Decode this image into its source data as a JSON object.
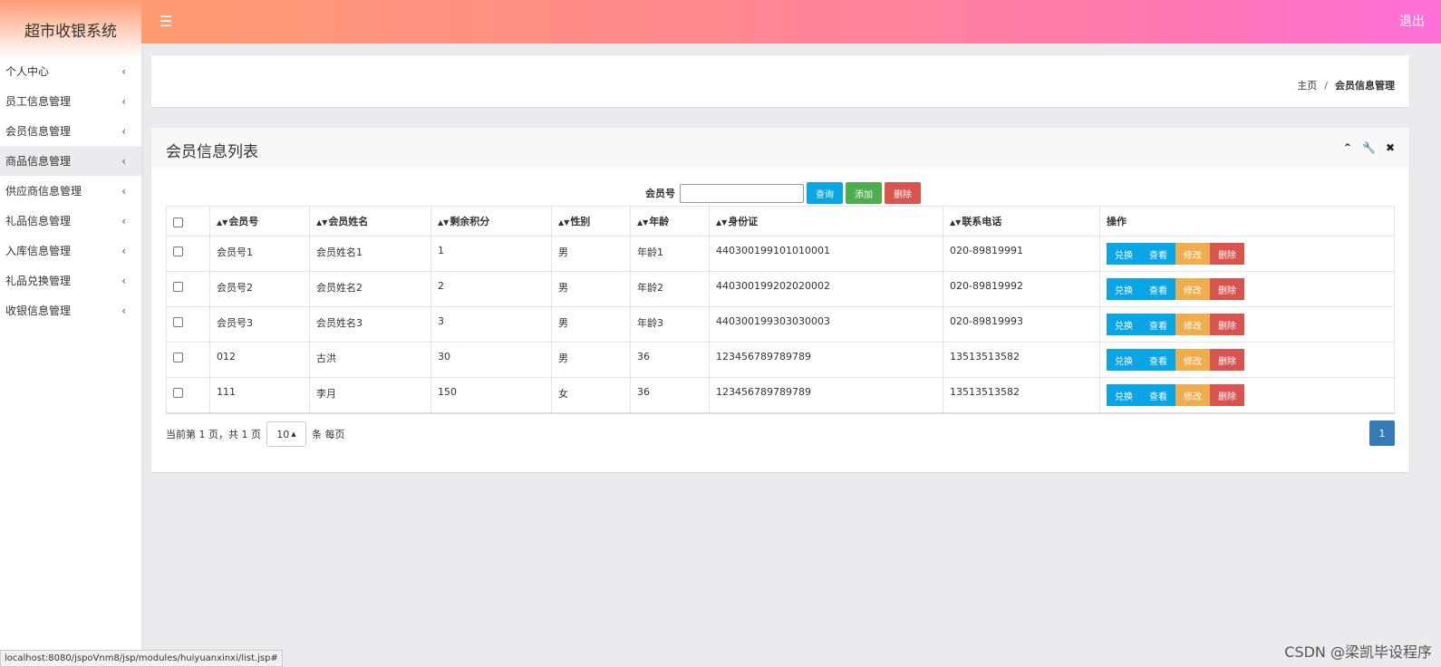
{
  "app": {
    "title": "超市收银系统",
    "logout_label": "退出",
    "menu_icon": "hamburger-icon"
  },
  "sidebar": {
    "items": [
      {
        "label": "个人中心",
        "active": false
      },
      {
        "label": "员工信息管理",
        "active": false
      },
      {
        "label": "会员信息管理",
        "active": false
      },
      {
        "label": "商品信息管理",
        "active": true
      },
      {
        "label": "供应商信息管理",
        "active": false
      },
      {
        "label": "礼品信息管理",
        "active": false
      },
      {
        "label": "入库信息管理",
        "active": false
      },
      {
        "label": "礼品兑换管理",
        "active": false
      },
      {
        "label": "收银信息管理",
        "active": false
      }
    ],
    "chevron": "‹"
  },
  "breadcrumb": {
    "home": "主页",
    "separator": "/",
    "current": "会员信息管理"
  },
  "panel": {
    "title": "会员信息列表",
    "tools": [
      "chevron-up-icon",
      "wrench-icon",
      "close-icon"
    ]
  },
  "search": {
    "label": "会员号",
    "value": "",
    "query_button": "查询",
    "add_button": "添加",
    "delete_button": "删除"
  },
  "table": {
    "columns": [
      "会员号",
      "会员姓名",
      "剩余积分",
      "性别",
      "年龄",
      "身份证",
      "联系电话",
      "操作"
    ],
    "rows": [
      [
        "会员号1",
        "会员姓名1",
        "1",
        "男",
        "年龄1",
        "440300199101010001",
        "020-89819991"
      ],
      [
        "会员号2",
        "会员姓名2",
        "2",
        "男",
        "年龄2",
        "440300199202020002",
        "020-89819992"
      ],
      [
        "会员号3",
        "会员姓名3",
        "3",
        "男",
        "年龄3",
        "440300199303030003",
        "020-89819993"
      ],
      [
        "012",
        "古洪",
        "30",
        "男",
        "36",
        "123456789789789",
        "13513513582"
      ],
      [
        "111",
        "李月",
        "150",
        "女",
        "36",
        "123456789789789",
        "13513513582"
      ]
    ],
    "row_actions": [
      "兑换",
      "查看",
      "修改",
      "删除"
    ]
  },
  "pager": {
    "info": "当前第 1 页，共 1 页",
    "page_size": "10",
    "per_page_suffix": "条 每页",
    "current_page": "1"
  },
  "statusbar": {
    "url": "localhost:8080/jspoVnm8/jsp/modules/huiyuanxinxi/list.jsp#"
  },
  "watermark": "CSDN @梁凯毕设程序",
  "colors": {
    "primary": "#0aa5e4",
    "success": "#4cae4c",
    "danger": "#d9534f",
    "warning": "#f0ad4e",
    "page_active": "#337ab7"
  }
}
